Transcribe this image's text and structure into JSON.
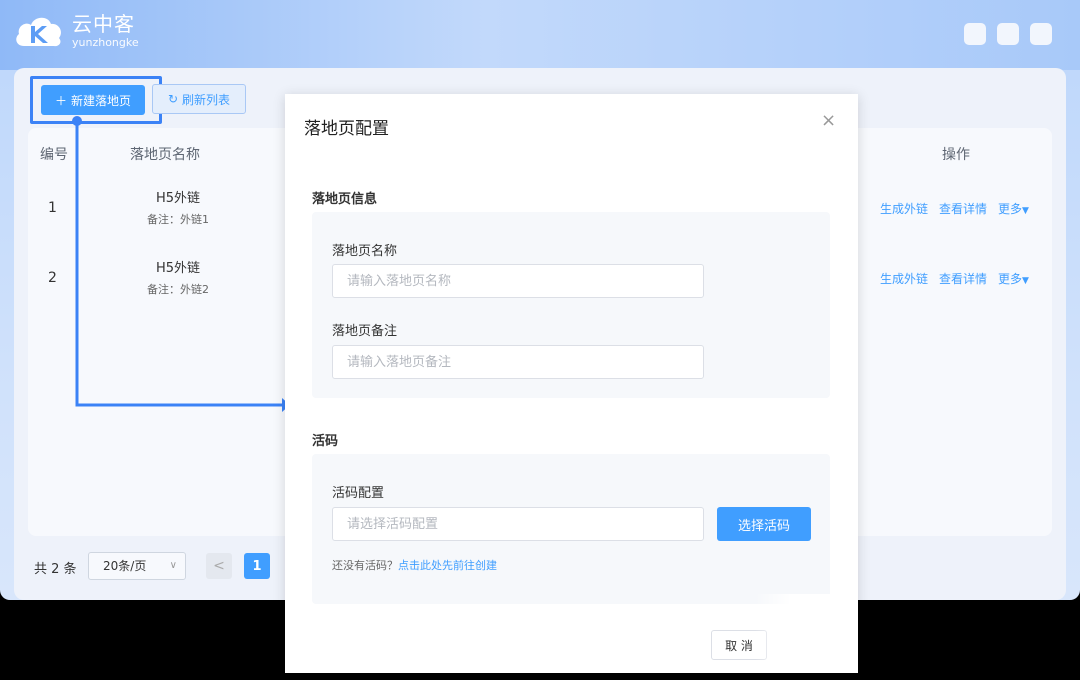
{
  "brand": {
    "name_cn": "云中客",
    "name_en": "yunzhongke"
  },
  "toolbar": {
    "new_label": "新建落地页",
    "new_icon": "plus-icon",
    "refresh_label": "刷新列表",
    "refresh_icon": "refresh-icon"
  },
  "table": {
    "headers": {
      "id": "编号",
      "name": "落地页名称",
      "actions": "操作"
    },
    "rows": [
      {
        "id": "1",
        "name": "H5外链",
        "note": "备注：外链1"
      },
      {
        "id": "2",
        "name": "H5外链",
        "note": "备注：外链2"
      }
    ],
    "actions": {
      "generate": "生成外链",
      "detail": "查看详情",
      "more": "更多"
    }
  },
  "pagination": {
    "total": "共 2 条",
    "page_size": "20条/页",
    "current": "1",
    "prev_glyph": "<"
  },
  "modal": {
    "title": "落地页配置",
    "close_glyph": "×",
    "section1_title": "落地页信息",
    "name_label": "落地页名称",
    "name_placeholder": "请输入落地页名称",
    "note_label": "落地页备注",
    "note_placeholder": "请输入落地页备注",
    "section2_title": "活码",
    "code_label": "活码配置",
    "code_placeholder": "请选择活码配置",
    "pick_button": "选择活码",
    "hint_text": "还没有活码？",
    "hint_link": "点击此处先前往创建",
    "cancel_label": "取 消"
  },
  "colors": {
    "primary": "#409eff",
    "highlight": "#3b82f6"
  }
}
